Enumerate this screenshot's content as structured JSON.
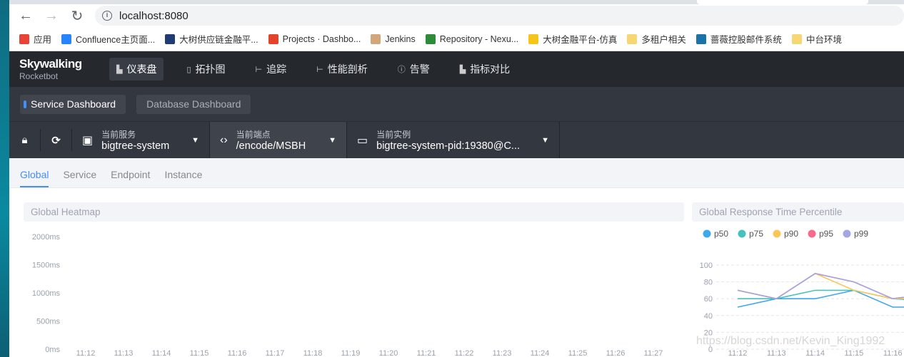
{
  "browser": {
    "url": "localhost:8080",
    "back_icon": "arrow-left",
    "forward_icon": "arrow-right",
    "reload_icon": "reload"
  },
  "bookmarks": [
    {
      "label": "应用",
      "color": "#ea4335"
    },
    {
      "label": "Confluence主页面...",
      "color": "#2684ff"
    },
    {
      "label": "大树供应链金融平...",
      "color": "#1f3b73"
    },
    {
      "label": "Projects · Dashbo...",
      "color": "#e24329"
    },
    {
      "label": "Jenkins",
      "color": "#d2a679"
    },
    {
      "label": "Repository - Nexu...",
      "color": "#2e8b3a"
    },
    {
      "label": "大树金融平台-仿真",
      "color": "#f5c518"
    },
    {
      "label": "多租户相关",
      "color": "#f7d774"
    },
    {
      "label": "蔷薇控股邮件系统",
      "color": "#1a73a8"
    },
    {
      "label": "中台环境",
      "color": "#f7d774"
    }
  ],
  "nav": {
    "logo": "Skywalking",
    "logo_sub": "Rocketbot",
    "items": [
      {
        "label": "仪表盘",
        "active": true
      },
      {
        "label": "拓扑图"
      },
      {
        "label": "追踪"
      },
      {
        "label": "性能剖析"
      },
      {
        "label": "告警"
      },
      {
        "label": "指标对比"
      }
    ]
  },
  "dashboards": [
    {
      "label": "Service Dashboard",
      "active": true
    },
    {
      "label": "Database Dashboard"
    }
  ],
  "selectors": [
    {
      "label": "当前服务",
      "value": "bigtree-system"
    },
    {
      "label": "当前端点",
      "value": "/encode/MSBH"
    },
    {
      "label": "当前实例",
      "value": "bigtree-system-pid:19380@C..."
    }
  ],
  "subtabs": [
    {
      "label": "Global",
      "active": true
    },
    {
      "label": "Service"
    },
    {
      "label": "Endpoint"
    },
    {
      "label": "Instance"
    }
  ],
  "watermark": "https://blog.csdn.net/Kevin_King1992",
  "chart_data": [
    {
      "type": "heatmap",
      "title": "Global Heatmap",
      "y_ticks": [
        "2000ms",
        "1500ms",
        "1000ms",
        "500ms",
        "0ms"
      ],
      "x": [
        "11:12",
        "11:13",
        "11:14",
        "11:15",
        "11:16",
        "11:17",
        "11:18",
        "11:19",
        "11:20",
        "11:21",
        "11:22",
        "11:23",
        "11:24",
        "11:25",
        "11:26",
        "11:27"
      ],
      "values": []
    },
    {
      "type": "line",
      "title": "Global Response Time Percentile",
      "ylim": [
        0,
        100
      ],
      "y_ticks": [
        0,
        20,
        40,
        60,
        80,
        100
      ],
      "grid": true,
      "legend": "top-left",
      "x": [
        "11:12",
        "11:13",
        "11:14",
        "11:15",
        "11:16"
      ],
      "series": [
        {
          "name": "p50",
          "color": "#3fa7ec",
          "values": [
            50,
            60,
            60,
            70,
            50,
            50
          ]
        },
        {
          "name": "p75",
          "color": "#45c2c0",
          "values": [
            60,
            60,
            70,
            70,
            60,
            57
          ]
        },
        {
          "name": "p90",
          "color": "#fcc757",
          "values": [
            70,
            60,
            90,
            70,
            60,
            60
          ]
        },
        {
          "name": "p95",
          "color": "#fa6a86",
          "values": [
            70,
            60,
            90,
            80,
            60,
            66
          ]
        },
        {
          "name": "p99",
          "color": "#a4a6e3",
          "values": [
            70,
            60,
            90,
            80,
            60,
            66
          ]
        }
      ]
    }
  ]
}
